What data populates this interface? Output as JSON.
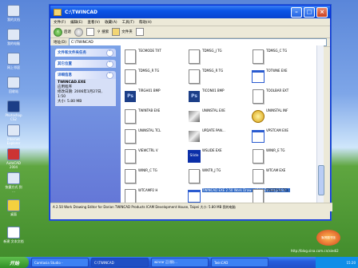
{
  "watermark": {
    "logo": "优酷",
    "badge": "聚贤图书馆",
    "url": "http://blog.sina.com.cn/xiedi2"
  },
  "desktop_icons": [
    {
      "label": "我的文档"
    },
    {
      "label": "我的电脑"
    },
    {
      "label": "网上邻居"
    },
    {
      "label": "回收站"
    },
    {
      "label": "Photoshop CS2"
    },
    {
      "label": "Internet Explorer"
    },
    {
      "label": "AutoCAD 2004"
    },
    {
      "label": "快捷方式 到 ..."
    },
    {
      "label": "桌面"
    },
    {
      "label": "新建 文本文档"
    }
  ],
  "window": {
    "title": "C:\\TWINCAD",
    "menu": [
      "文件(F)",
      "编辑(E)",
      "查看(V)",
      "收藏(A)",
      "工具(T)",
      "帮助(H)"
    ],
    "toolbar": {
      "back": "后退",
      "search": "搜索",
      "folders": "文件夹"
    },
    "address_label": "地址(D)",
    "address_value": "C:\\TWINCAD"
  },
  "left_pane": {
    "tasks_title": "文件和文件夹任务",
    "places_title": "其它位置",
    "details_title": "详细信息",
    "details": {
      "name": "TWINCAD.EXE",
      "type": "应用程序",
      "modified": "修改日期: 2006年1月27日,",
      "time": "1:50",
      "size": "大小: 5.80 MB"
    }
  },
  "files": [
    {
      "name": "TECMODE TXT",
      "icon": "doc"
    },
    {
      "name": "TDMSG_J TG",
      "icon": "doc"
    },
    {
      "name": "TDMSG_C TG",
      "icon": "doc"
    },
    {
      "name": "TDMSG_R TG",
      "icon": "doc"
    },
    {
      "name": "TDMSG_R TG",
      "icon": "doc"
    },
    {
      "name": "TOTWNE EXE",
      "icon": "exe"
    },
    {
      "name": "TIRGH01 BMP",
      "icon": "ps"
    },
    {
      "name": "TICON01 BMP",
      "icon": "ps"
    },
    {
      "name": "TOOLBAR EXT",
      "icon": "doc"
    },
    {
      "name": "TWINTAB EXE",
      "icon": "doc"
    },
    {
      "name": "UNINSTAL EXE",
      "icon": "tool"
    },
    {
      "name": "UNINSTAL INF",
      "icon": "gear"
    },
    {
      "name": "UNINSTAL TCL",
      "icon": "doc"
    },
    {
      "name": "UPDATE PAN...",
      "icon": "tool"
    },
    {
      "name": "VPSTCAM EXE",
      "icon": "exe"
    },
    {
      "name": "VIEWCTRL V",
      "icon": "doc"
    },
    {
      "name": "WSLIDE EXE",
      "icon": "slide"
    },
    {
      "name": "WINIR_E TG",
      "icon": "doc"
    },
    {
      "name": "WINIR_C TG",
      "icon": "doc"
    },
    {
      "name": "WINTR_J TG",
      "icon": "doc"
    },
    {
      "name": "WTCAM EXE",
      "icon": "doc"
    },
    {
      "name": "WTCAMP2 H",
      "icon": "doc"
    },
    {
      "name": "TWINCAD EXE 2.50 Work Draw... ICAM Development ...",
      "icon": "exe",
      "selected": true
    },
    {
      "name": "FREETYLE TCL",
      "icon": "doc"
    }
  ],
  "status_bar": "A 2.50 Work Drawing Editor for Dorian TWINCAD Products  ICAM Development House, Taipei  大小: 5.80 MB   我的电脑",
  "taskbar": {
    "start": "开始",
    "items": [
      "Camtasia Studio -",
      "C:\\TWINCAD",
      "winrar 正(预)...",
      "TwinCAD"
    ],
    "clock": "15:20"
  }
}
